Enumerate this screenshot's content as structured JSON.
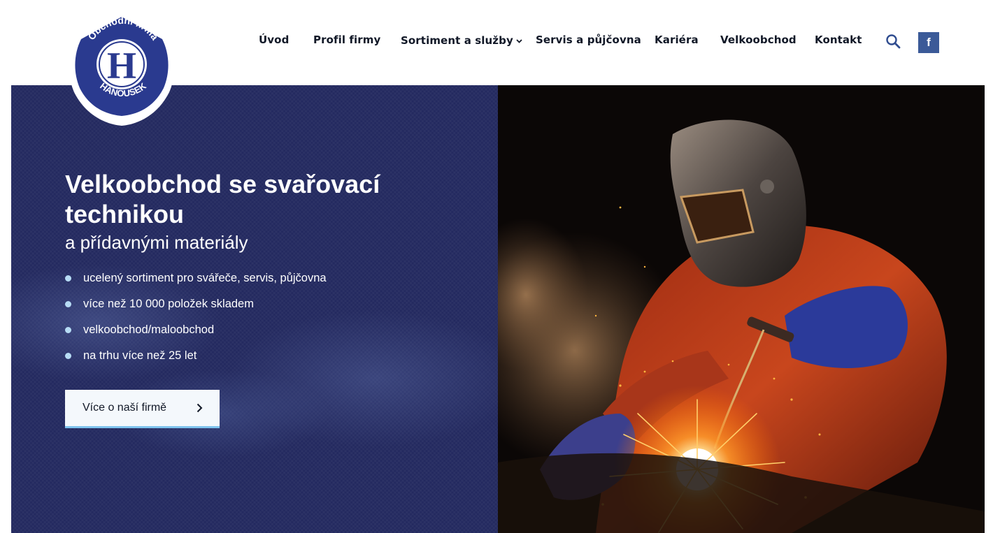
{
  "brand": {
    "logo_top": "Obchodní firma",
    "logo_bottom": "HANOUSEK",
    "logo_monogram": "H",
    "color_navy": "#2a3a8f",
    "color_hero": "#23295f"
  },
  "nav": {
    "items": [
      {
        "label": "Úvod"
      },
      {
        "label": "Profil firmy"
      },
      {
        "label": "Sortiment a služby",
        "has_dropdown": true
      },
      {
        "label": "Servis a půjčovna"
      },
      {
        "label": "Kariéra"
      },
      {
        "label": "Velkoobchod"
      },
      {
        "label": "Kontakt"
      }
    ],
    "search_icon": "search-icon",
    "facebook_label": "f",
    "facebook_color": "#3b5a98"
  },
  "hero": {
    "title": "Velkoobchod se svařovací technikou",
    "subtitle": "a přídavnými materiály",
    "bullets": [
      "ucelený sortiment pro svářeče, servis, půjčovna",
      "více než 10 000 položek skladem",
      "velkoobchod/maloobchod",
      "na trhu více než 25 let"
    ],
    "bullet_color": "#b7dcf5",
    "cta_label": "Více o naší firmě",
    "cta_accent": "#7ec3ee"
  }
}
